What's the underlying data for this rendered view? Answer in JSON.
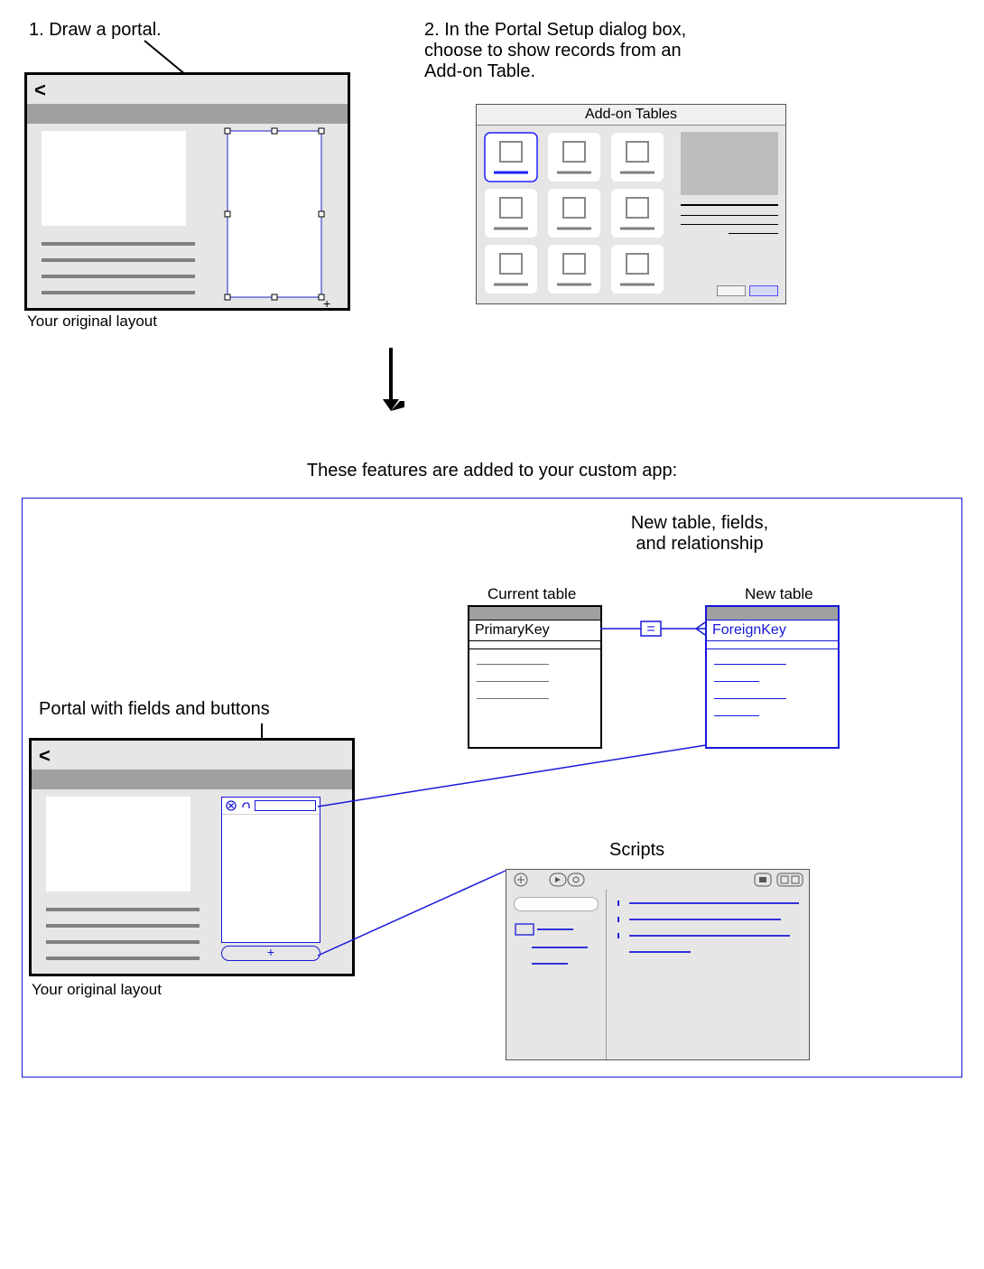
{
  "step1": {
    "text": "1. Draw a portal.",
    "caption": "Your original layout",
    "back_label": "<"
  },
  "step2": {
    "text_l1": "2. In the Portal Setup dialog box,",
    "text_l2": "choose to show records from an",
    "text_l3": "Add-on Table.",
    "dialog_title": "Add-on Tables"
  },
  "result": {
    "intro": "These features are added to your custom app:",
    "portal_heading": "Portal with fields and buttons",
    "portal_caption": "Your original layout",
    "portal_back": "<",
    "portal_plus": "+",
    "rel_heading_l1": "New table, fields,",
    "rel_heading_l2": "and relationship",
    "current_table_label": "Current table",
    "new_table_label": "New table",
    "primary_key": "PrimaryKey",
    "foreign_key": "ForeignKey",
    "equals": "=",
    "scripts_heading": "Scripts"
  }
}
